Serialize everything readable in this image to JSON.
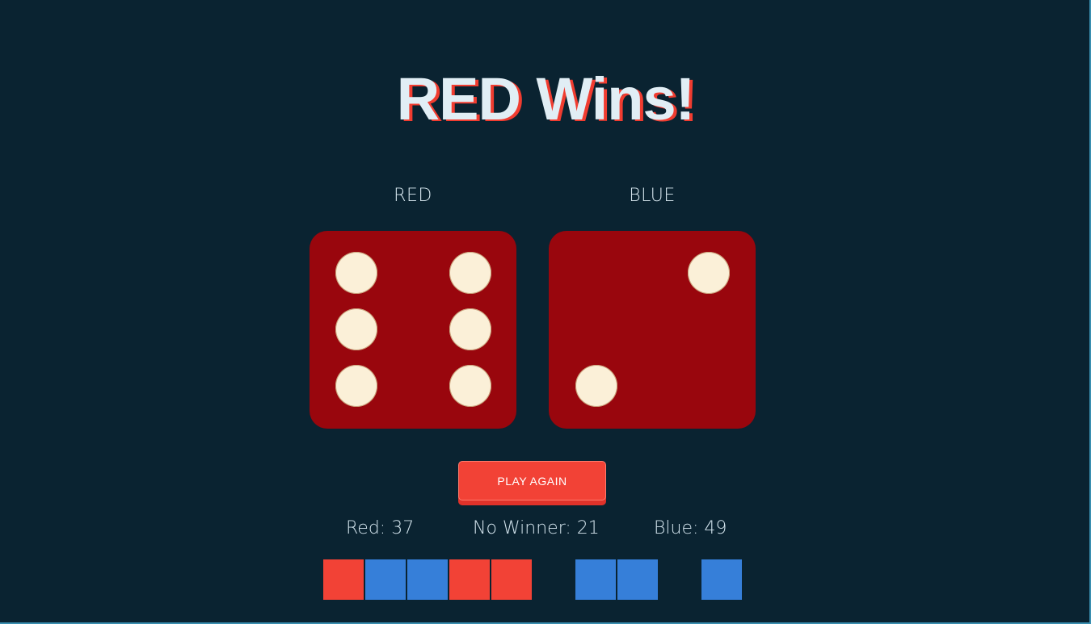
{
  "headline": "RED Wins!",
  "players": {
    "red": {
      "label": "RED",
      "die_value": 6
    },
    "blue": {
      "label": "BLUE",
      "die_value": 2
    }
  },
  "play_button": {
    "label": "PLAY AGAIN"
  },
  "scores": {
    "red": "Red: 37",
    "draw": "No Winner: 21",
    "blue": "Blue: 49"
  },
  "history": [
    "red",
    "blue",
    "blue",
    "red",
    "red",
    "none",
    "blue",
    "blue",
    "none",
    "blue"
  ],
  "colors": {
    "background": "#0a2331",
    "die": "#99060d",
    "pip": "#fbf0d8",
    "red_accent": "#f24236",
    "blue_accent": "#367fd9",
    "text": "#d7e7ef"
  }
}
